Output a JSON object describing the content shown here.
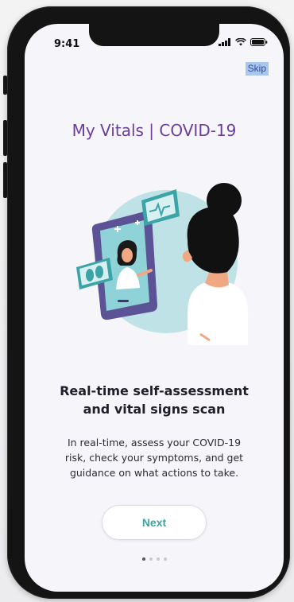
{
  "status_bar": {
    "time": "9:41",
    "icons": [
      "signal-icon",
      "wifi-icon",
      "battery-icon"
    ]
  },
  "skip_label": "Skip",
  "title": "My Vitals | COVID-19",
  "illustration": {
    "name": "woman-vitals-scan-illustration",
    "colors": {
      "circle": "#bfe2e6",
      "tablet": "#5b5396",
      "hair": "#111111",
      "skin": "#f0a883",
      "accent": "#3aa4a6"
    }
  },
  "heading_line1": "Real-time self-assessment",
  "heading_line2": "and vital signs scan",
  "description": [
    "In real-time, assess your COVID-19",
    "risk, check your symptoms, and get",
    "guidance on what actions to take."
  ],
  "next_label": "Next",
  "pagination": {
    "total": 4,
    "active_index": 0
  },
  "colors": {
    "title": "#6a3e9a",
    "button_text": "#3aa4a6",
    "skip_bg": "#a9c6ee"
  }
}
